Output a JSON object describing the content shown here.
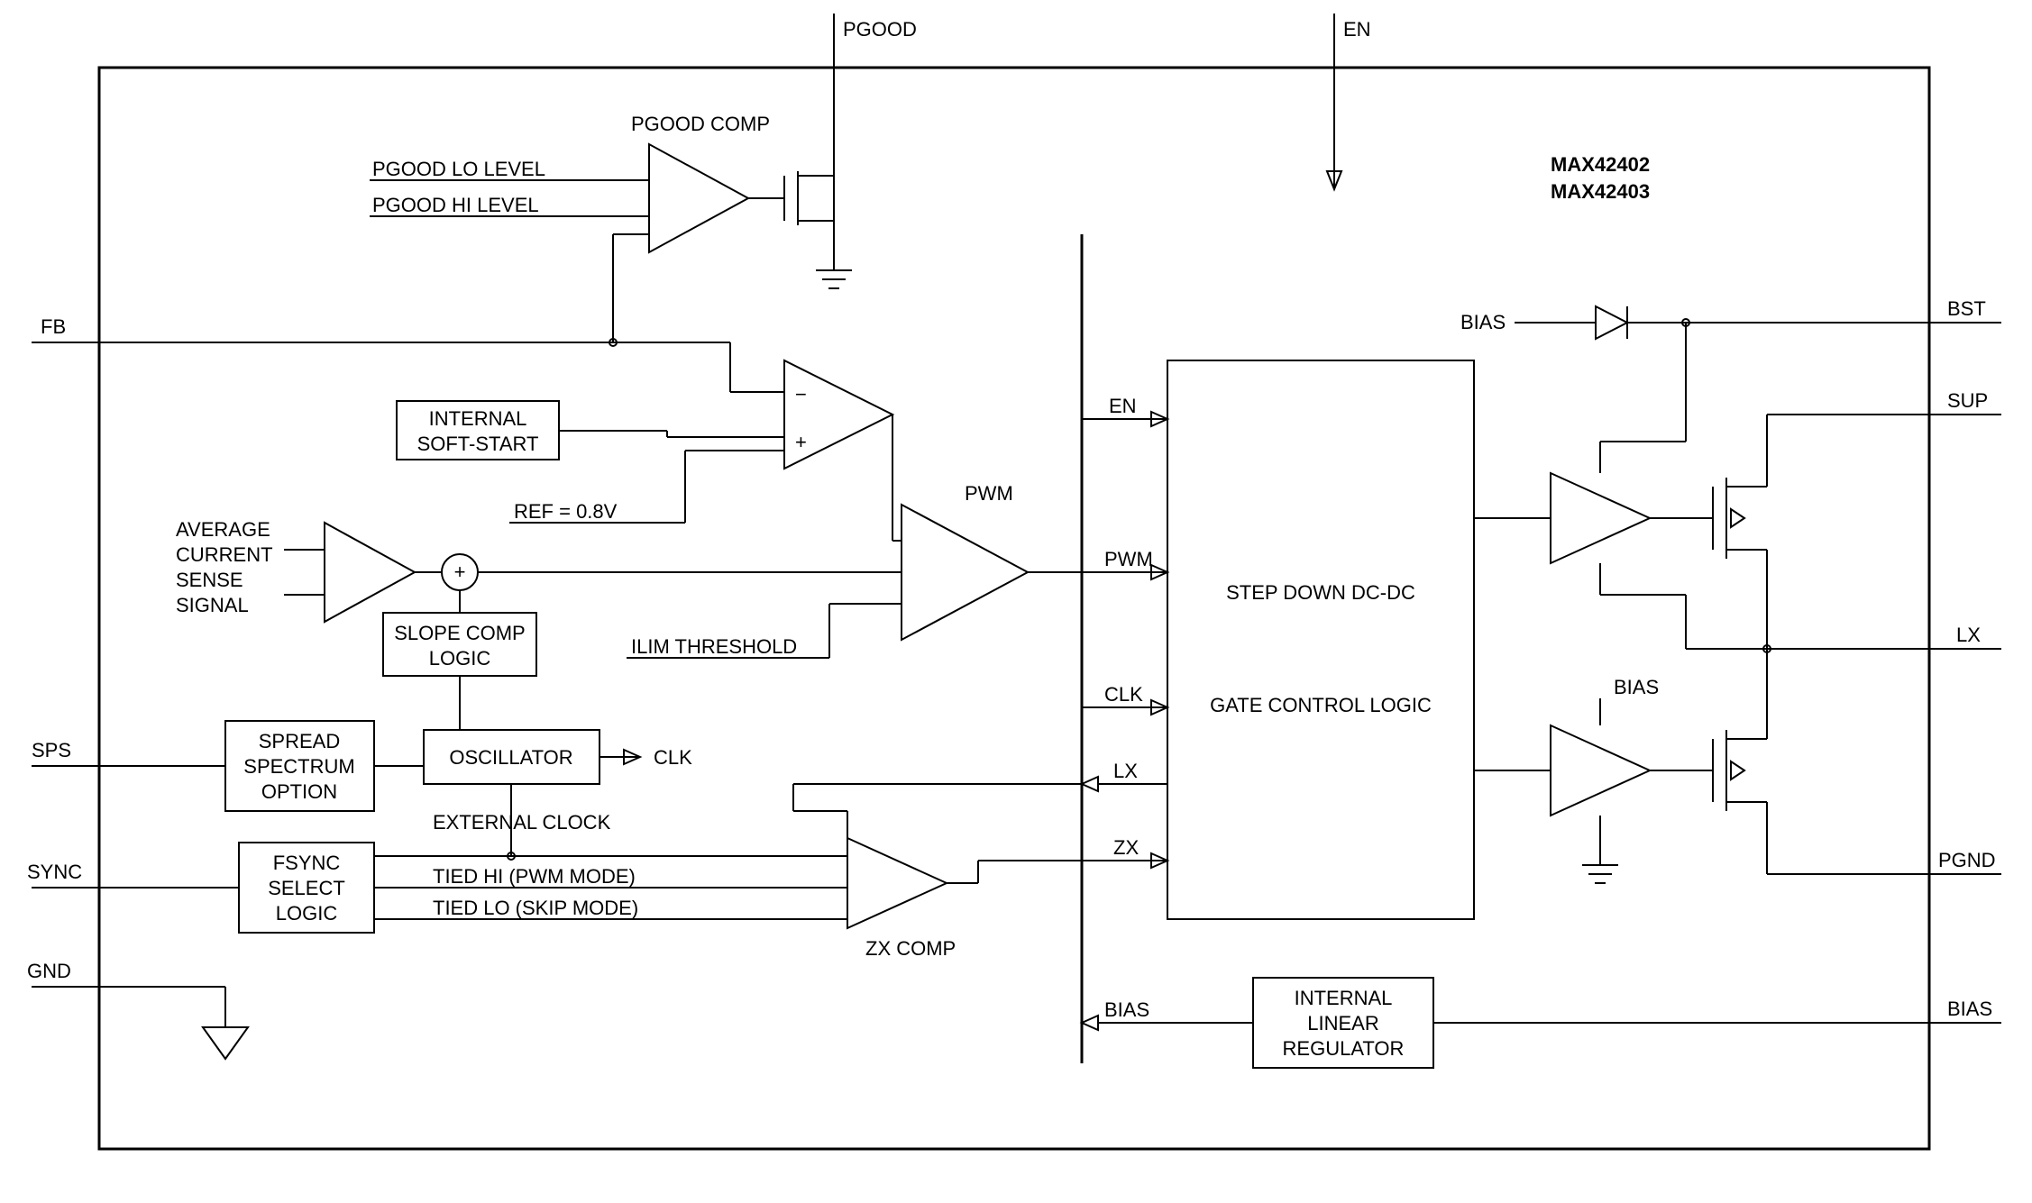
{
  "parts": {
    "line1": "MAX42402",
    "line2": "MAX42403"
  },
  "pins": {
    "pgood": "PGOOD",
    "en": "EN",
    "fb": "FB",
    "sps": "SPS",
    "sync": "SYNC",
    "gnd": "GND",
    "bst": "BST",
    "sup": "SUP",
    "lx": "LX",
    "pgnd": "PGND",
    "bias": "BIAS"
  },
  "labels": {
    "pgood_comp": "PGOOD COMP",
    "pgood_lo": "PGOOD LO LEVEL",
    "pgood_hi": "PGOOD HI LEVEL",
    "internal_softstart": {
      "l1": "INTERNAL",
      "l2": "SOFT-START"
    },
    "ref": "REF = 0.8V",
    "avg_current": {
      "l1": "AVERAGE",
      "l2": "CURRENT",
      "l3": "SENSE",
      "l4": "SIGNAL"
    },
    "slope_comp": {
      "l1": "SLOPE COMP",
      "l2": "LOGIC"
    },
    "ilim": "ILIM THRESHOLD",
    "pwm": "PWM",
    "spread_spectrum": {
      "l1": "SPREAD",
      "l2": "SPECTRUM",
      "l3": "OPTION"
    },
    "oscillator": "OSCILLATOR",
    "clk_out": "CLK",
    "external_clock": "EXTERNAL CLOCK",
    "fsync": {
      "l1": "FSYNC",
      "l2": "SELECT",
      "l3": "LOGIC"
    },
    "tied_hi": "TIED HI (PWM MODE)",
    "tied_lo": "TIED LO (SKIP MODE)",
    "zx_comp": "ZX COMP",
    "step_down": "STEP DOWN DC-DC",
    "gate_control": "GATE CONTROL LOGIC",
    "internal_linreg": {
      "l1": "INTERNAL",
      "l2": "LINEAR",
      "l3": "REGULATOR"
    },
    "bias_label": "BIAS"
  },
  "bus": {
    "en": "EN",
    "pwm": "PWM",
    "clk": "CLK",
    "lx": "LX",
    "zx": "ZX",
    "bias": "BIAS"
  }
}
